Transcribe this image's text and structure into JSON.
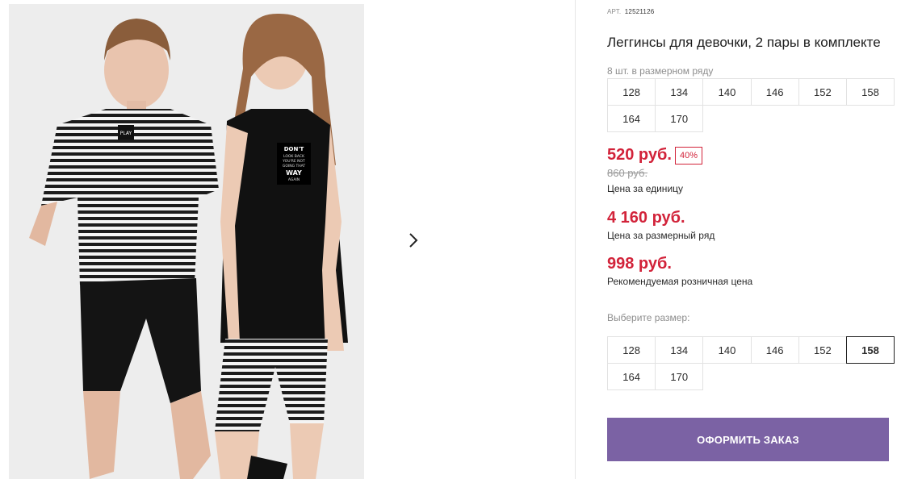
{
  "product": {
    "art_label": "АРТ.",
    "art_value": "12521126",
    "title": "Леггинсы для девочки, 2 пары в комплекте"
  },
  "size_row": {
    "label": "8 шт. в размерном ряду",
    "sizes": [
      "128",
      "134",
      "140",
      "146",
      "152",
      "158",
      "164",
      "170"
    ]
  },
  "prices": {
    "unit_price": "520 руб.",
    "discount": "40%",
    "old_price": "860 руб.",
    "unit_label": "Цена за единицу",
    "row_price": "4 160 руб.",
    "row_label": "Цена за размерный ряд",
    "retail_price": "998 руб.",
    "retail_label": "Рекомендуемая розничная цена"
  },
  "size_select": {
    "label": "Выберите размер:",
    "sizes": [
      "128",
      "134",
      "140",
      "146",
      "152",
      "158",
      "164",
      "170"
    ],
    "selected": "158"
  },
  "actions": {
    "order_label": "ОФОРМИТЬ ЗАКАЗ"
  },
  "gallery": {
    "next_icon": "chevron-right-icon",
    "tshirt_print_1": "PLAY",
    "tank_print_lines": [
      "DON'T",
      "LOOK BACK",
      "YOU'RE NOT",
      "GOING THAT",
      "WAY",
      "AGAIN"
    ]
  },
  "colors": {
    "price_red": "#d2233a",
    "order_button": "#7b62a4"
  }
}
